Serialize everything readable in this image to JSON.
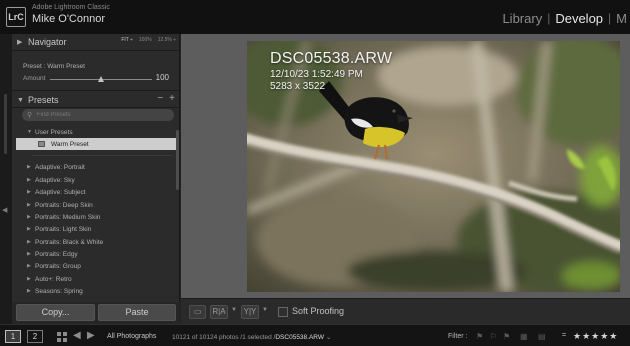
{
  "app": {
    "badge": "LrC",
    "name": "Adobe Lightroom Classic",
    "user": "Mike O'Connor"
  },
  "modules": {
    "library": "Library",
    "develop": "Develop",
    "map_partial": "M",
    "separator": "|"
  },
  "navigator": {
    "title": "Navigator",
    "zoom_fit": "FIT ÷",
    "zoom_100": "100%",
    "zoom_125": "12.5% ÷"
  },
  "preset_amount": {
    "preset_line": "Preset : Warm Preset",
    "amount_label": "Amount",
    "amount_value": "100",
    "amount_fraction": 0.5
  },
  "presets": {
    "title": "Presets",
    "minus": "−",
    "plus": "+",
    "search_placeholder": "Find Presets",
    "groups": [
      "User Presets",
      "Adaptive: Portrait",
      "Adaptive: Sky",
      "Adaptive: Subject",
      "Portraits: Deep Skin",
      "Portraits: Medium Skin",
      "Portraits: Light Skin",
      "Portraits: Black & White",
      "Portraits: Edgy",
      "Portraits: Group",
      "Auto+: Retro",
      "Seasons: Spring"
    ],
    "selected_preset": "Warm Preset"
  },
  "buttons": {
    "copy": "Copy...",
    "paste": "Paste"
  },
  "photo_info": {
    "filename": "DSC05538.ARW",
    "datetime": "12/10/23 1:52:49 PM",
    "dimensions": "5283 x 3522"
  },
  "toolbar": {
    "ref_view": "R|A",
    "before_after": "Y|Y",
    "soft_proofing": "Soft Proofing"
  },
  "filmstrip": {
    "screen_1": "1",
    "screen_2": "2",
    "source": "All Photographs",
    "status_prefix": "10121 of 10124 photos /1 selected /",
    "status_filename": "DSC05538.ARW",
    "status_caret": "⌄",
    "filter_label": "Filter :",
    "equals": "=",
    "stars": "★★★★★"
  },
  "colors": {
    "accent_text": "#e6e6e6",
    "panel_bg": "#2b2b2b",
    "selected_row": "#cdcdcd",
    "bird_breast": "#d7c32a"
  },
  "icons": {
    "navigator_toggle": "triangle-right-icon",
    "presets_toggle": "triangle-down-icon",
    "search": "search-icon",
    "preset_item": "preset-icon",
    "grid": "grid-icon",
    "prev": "arrow-left-icon",
    "next": "arrow-right-icon"
  }
}
